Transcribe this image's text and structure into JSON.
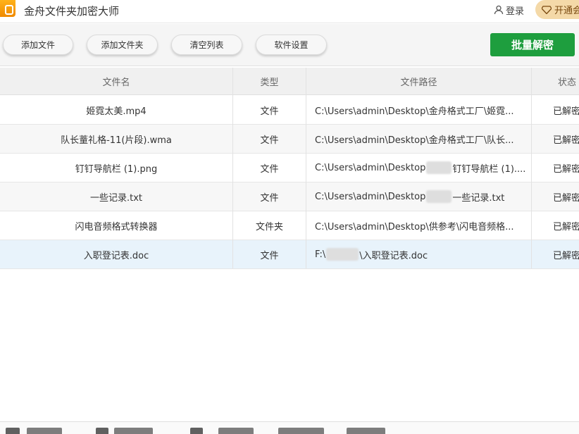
{
  "app": {
    "title": "金舟文件夹加密大师"
  },
  "header": {
    "login_label": "登录",
    "vip_label": "开通会"
  },
  "toolbar": {
    "add_file": "添加文件",
    "add_folder": "添加文件夹",
    "clear_list": "清空列表",
    "settings": "软件设置",
    "batch_decrypt": "批量解密"
  },
  "table": {
    "columns": [
      "文件名",
      "类型",
      "文件路径",
      "状态"
    ],
    "rows": [
      {
        "name": "姬霓太美.mp4",
        "type": "文件",
        "path": "C:\\Users\\admin\\Desktop\\金舟格式工厂\\姬霓...",
        "status": "已解密"
      },
      {
        "name": "队长蕫礼格-11(片段).wma",
        "type": "文件",
        "path": "C:\\Users\\admin\\Desktop\\金舟格式工厂\\队长...",
        "status": "已解密"
      },
      {
        "name": "钉钉导航栏 (1).png",
        "type": "文件",
        "path_a": "C:\\Users\\admin\\Desktop",
        "path_b": "钉钉导航栏 (1)....",
        "status": "已解密"
      },
      {
        "name": "一些记录.txt",
        "type": "文件",
        "path_a": "C:\\Users\\admin\\Desktop",
        "path_b": "一些记录.txt",
        "status": "已解密"
      },
      {
        "name": "闪电音频格式转换器",
        "type": "文件夹",
        "path": "C:\\Users\\admin\\Desktop\\供参考\\闪电音频格...",
        "status": "已解密"
      },
      {
        "name": "入职登记表.doc",
        "type": "文件",
        "path_a": "F:\\",
        "path_b": "\\入职登记表.doc",
        "status": "已解密"
      }
    ]
  },
  "colors": {
    "accent": "#1e9e3e",
    "vip_bg": "#f4d9a8",
    "selected_row": "#e8f3fb"
  }
}
